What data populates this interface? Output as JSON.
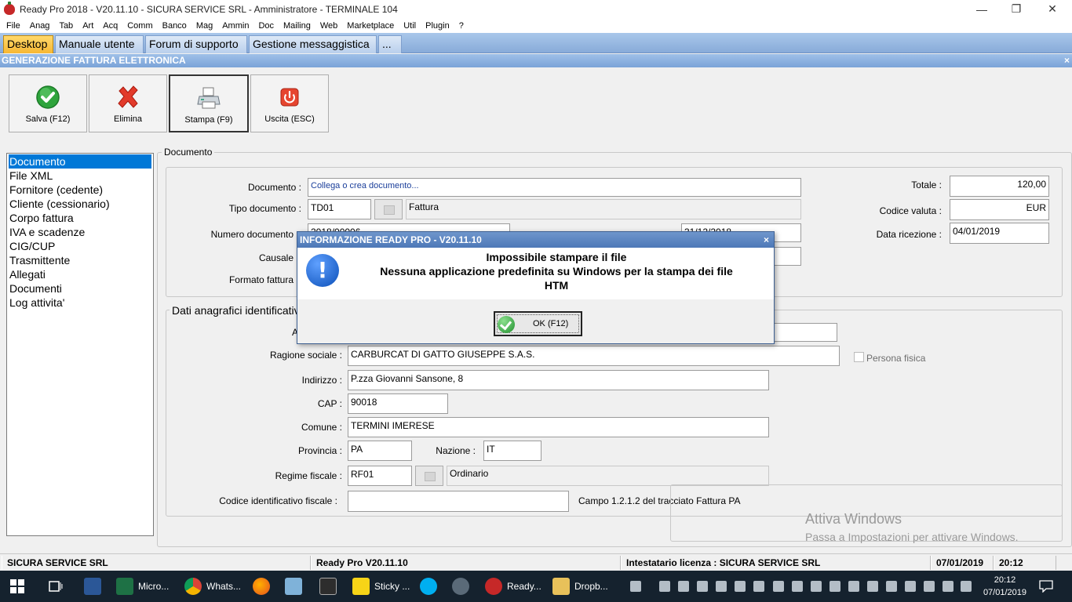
{
  "window": {
    "title": "Ready Pro 2018 - V20.11.10 - SICURA SERVICE SRL - Amministratore - TERMINALE 104",
    "minimize": "—",
    "maximize": "❐",
    "close": "✕"
  },
  "menu": [
    "File",
    "Anag",
    "Tab",
    "Art",
    "Acq",
    "Comm",
    "Banco",
    "Mag",
    "Ammin",
    "Doc",
    "Mailing",
    "Web",
    "Marketplace",
    "Util",
    "Plugin",
    "?"
  ],
  "tabs": [
    "Desktop",
    "Manuale utente",
    "Forum di supporto",
    "Gestione messaggistica",
    "..."
  ],
  "form_title": "GENERAZIONE FATTURA ELETTRONICA",
  "form_close": "×",
  "toolbar": {
    "save": "Salva (F12)",
    "delete": "Elimina",
    "print": "Stampa (F9)",
    "exit": "Uscita (ESC)"
  },
  "nav": [
    "Documento",
    "File XML",
    "Fornitore (cedente)",
    "Cliente (cessionario)",
    "Corpo fattura",
    "IVA e scadenze",
    "CIG/CUP",
    "Trasmittente",
    "Allegati",
    "Documenti",
    "Log attivita'"
  ],
  "documento": {
    "group_title": "Documento",
    "documento_label": "Documento :",
    "documento_link": "Collega o crea documento...",
    "tipo_label": "Tipo documento :",
    "tipo_code": "TD01",
    "tipo_desc": "Fattura",
    "numero_label": "Numero documento",
    "numero_value": "2018/00006",
    "data_value": "31/12/2018",
    "causale_label": "Causale",
    "formato_label": "Formato fattura",
    "totale_label": "Totale :",
    "totale_value": "120,00",
    "valuta_label": "Codice valuta :",
    "valuta_value": "EUR",
    "ricezione_label": "Data ricezione :",
    "ricezione_value": "04/01/2019"
  },
  "anagrafica": {
    "group_title": "Dati anagrafici identificativi",
    "a_label": "A",
    "ragione_label": "Ragione sociale :",
    "ragione_value": "CARBURCAT DI GATTO GIUSEPPE S.A.S.",
    "persona_fisica": "Persona fisica",
    "indirizzo_label": "Indirizzo :",
    "indirizzo_value": "P.zza Giovanni Sansone, 8",
    "cap_label": "CAP :",
    "cap_value": "90018",
    "comune_label": "Comune :",
    "comune_value": "TERMINI IMERESE",
    "provincia_label": "Provincia :",
    "provincia_value": "PA",
    "nazione_label": "Nazione :",
    "nazione_value": "IT",
    "regime_label": "Regime fiscale :",
    "regime_code": "RF01",
    "regime_desc": "Ordinario",
    "cf_label": "Codice identificativo fiscale :",
    "cf_value": "",
    "cf_note": "Campo 1.2.1.2 del tracciato Fattura PA"
  },
  "dialog": {
    "title": "INFORMAZIONE READY PRO - V20.11.10",
    "close": "×",
    "icon": "!",
    "line1": "Impossibile stampare il file",
    "line2": "Nessuna applicazione predefinita su Windows per la stampa dei file",
    "line3": "HTM",
    "ok": "OK (F12)"
  },
  "watermark": {
    "line1": "Attiva Windows",
    "line2": "Passa a Impostazioni per attivare Windows."
  },
  "statusbar": {
    "company": "SICURA SERVICE SRL",
    "version": "Ready Pro V20.11.10",
    "license": "Intestatario licenza : SICURA SERVICE SRL",
    "date": "07/01/2019",
    "time": "20:12"
  },
  "taskbar": {
    "apps": [
      "Micro...",
      "Whats...",
      "Sticky ...",
      "Ready...",
      "Dropb..."
    ],
    "clock_time": "20:12",
    "clock_date": "07/01/2019"
  },
  "colors": {
    "accent": "#0078d7",
    "tab_active": "#f7b733",
    "header_blue": "#7aa3d8",
    "taskbar": "#15222e"
  }
}
